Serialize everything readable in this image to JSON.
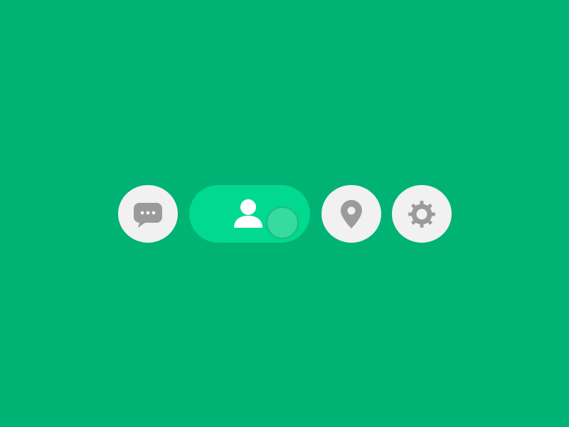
{
  "colors": {
    "background": "#00b274",
    "button_bg": "#f1f1f1",
    "icon_gray": "#9b9b9b",
    "pill_active": "#00d98f",
    "person_white": "#ffffff",
    "knob_fill": "#36dc9f",
    "knob_border": "#1fb981"
  },
  "nav": {
    "items": [
      {
        "id": "messages",
        "icon": "chat-bubble-icon",
        "active": false
      },
      {
        "id": "profile",
        "icon": "person-icon",
        "active": true
      },
      {
        "id": "location",
        "icon": "map-pin-icon",
        "active": false
      },
      {
        "id": "settings",
        "icon": "gear-icon",
        "active": false
      }
    ]
  }
}
